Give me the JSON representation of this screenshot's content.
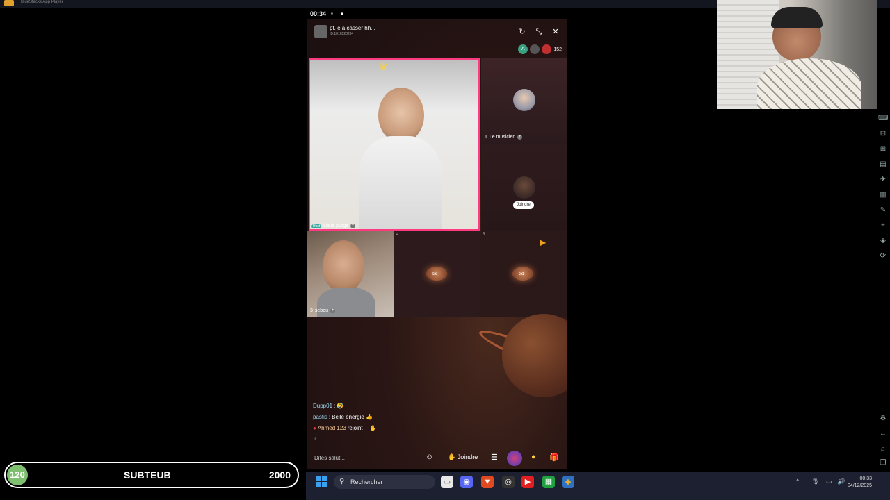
{
  "emulator": {
    "title": "BlueStacks App Player",
    "version": "5.22.110.1027 P64"
  },
  "status": {
    "time": "00:34"
  },
  "room": {
    "title": "pt. e a casser hh...",
    "id": "ID:1016528284",
    "viewer_count": "152",
    "viewer_avatar_initial": "A"
  },
  "seats": {
    "host_name": "lila la purge",
    "host_tag": "Host",
    "seat1_number": "1",
    "seat1_name": "Le musicien",
    "seat2_join": "Joindre",
    "seat3_number": "3",
    "seat3_name": "sebou",
    "seat4_number": "4",
    "seat5_number": "5"
  },
  "chat": [
    {
      "user": "Dupp01",
      "text": "🤣"
    },
    {
      "user": "pastis",
      "text": "Belle énergie 👍"
    },
    {
      "user": "Ahmed 123",
      "text": "rejoint"
    }
  ],
  "bottom_bar": {
    "say_hi": "Dites salut...",
    "join_label": "Joindre"
  },
  "sub_goal": {
    "count": "120",
    "label": "SUBTEUB",
    "target": "2000"
  },
  "taskbar": {
    "search_label": "Rechercher",
    "clock_time": "00:33",
    "clock_date": "04/12/2025"
  },
  "colors": {
    "host_border": "#ff3a80",
    "sub_badge": "#7ec070",
    "taskbar": "#1d2030"
  }
}
